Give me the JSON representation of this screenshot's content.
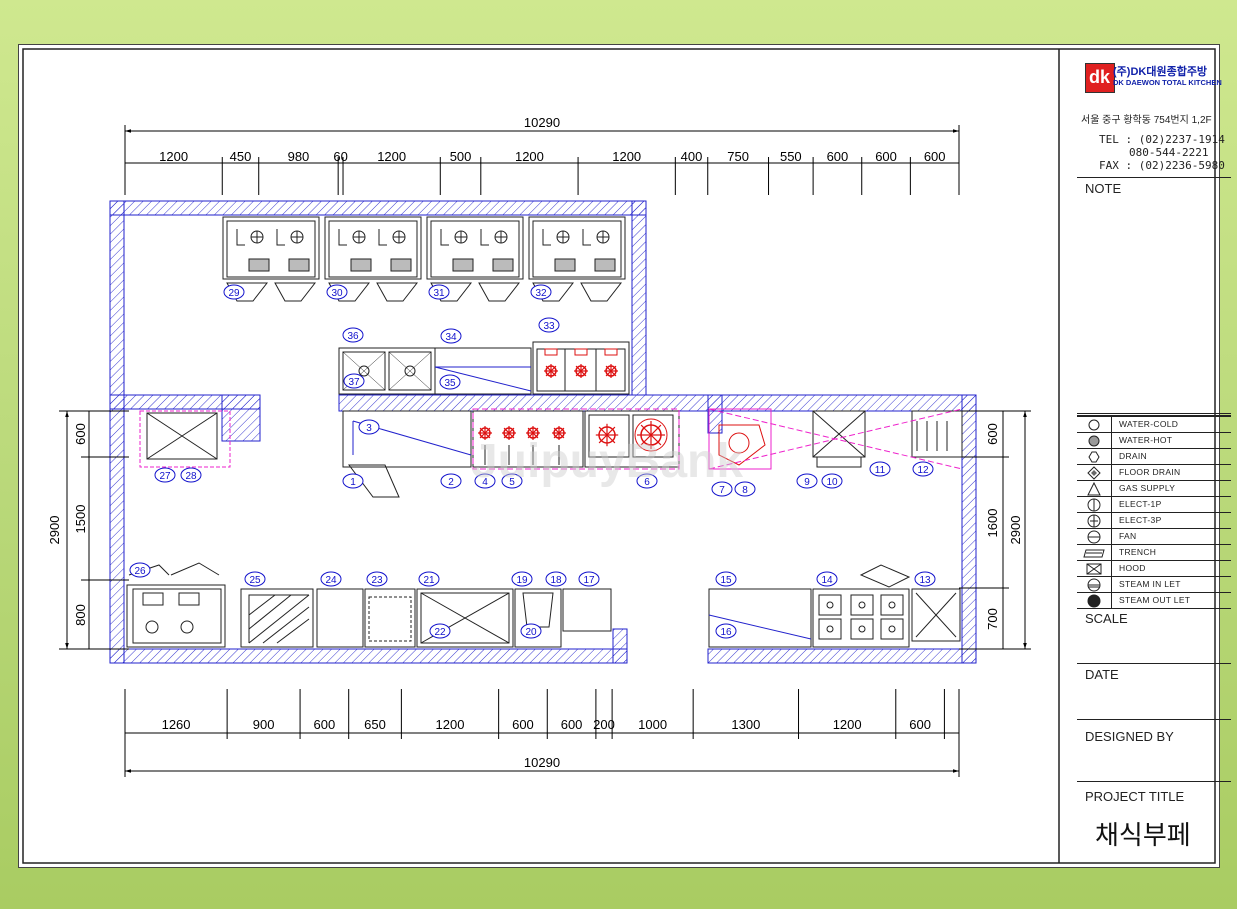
{
  "company": {
    "logo_text": "dk",
    "name_kr": "(주)DK대원종합주방",
    "name_en": "DK DAEWON TOTAL KITCHEN",
    "address": "서울 중구 황학동 754번지 1,2F",
    "tel": "TEL : (02)2237-1914",
    "tel2": "080-544-2221",
    "fax": "FAX : (02)2236-5980"
  },
  "title_block": {
    "note": "NOTE",
    "scale": "SCALE",
    "date": "DATE",
    "designed_by": "DESIGNED BY",
    "project_title_label": "PROJECT TITLE",
    "project_title": "채식부페"
  },
  "legend": [
    {
      "icon": "water-cold-icon",
      "label": "WATER-COLD"
    },
    {
      "icon": "water-hot-icon",
      "label": "WATER-HOT"
    },
    {
      "icon": "drain-icon",
      "label": "DRAIN"
    },
    {
      "icon": "floor-drain-icon",
      "label": "FLOOR DRAIN"
    },
    {
      "icon": "gas-supply-icon",
      "label": "GAS SUPPLY"
    },
    {
      "icon": "elect-1p-icon",
      "label": "ELECT-1P"
    },
    {
      "icon": "elect-3p-icon",
      "label": "ELECT-3P"
    },
    {
      "icon": "fan-icon",
      "label": "FAN"
    },
    {
      "icon": "trench-icon",
      "label": "TRENCH"
    },
    {
      "icon": "hood-icon",
      "label": "HOOD"
    },
    {
      "icon": "steam-in-let-icon",
      "label": "STEAM IN LET"
    },
    {
      "icon": "steam-out-let-icon",
      "label": "STEAM OUT LET"
    }
  ],
  "dimensions": {
    "top_total": "10290",
    "top_segments": [
      "1200",
      "450",
      "980",
      "60",
      "1200",
      "500",
      "1200",
      "1200",
      "400",
      "750",
      "550",
      "600",
      "600",
      "600"
    ],
    "bottom_total": "10290",
    "bottom_segments": [
      "1260",
      "900",
      "600",
      "650",
      "1200",
      "600",
      "600",
      "200",
      "1000",
      "1300",
      "1200",
      "600"
    ],
    "left_total": "2900",
    "left_segments": [
      "600",
      "1500",
      "800"
    ],
    "right_total": "2900",
    "right_segments": [
      "600",
      "1600",
      "700"
    ]
  },
  "equipment_numbers": [
    "29",
    "30",
    "31",
    "32",
    "36",
    "34",
    "33",
    "37",
    "35",
    "3",
    "1",
    "2",
    "4",
    "5",
    "6",
    "7",
    "8",
    "9",
    "10",
    "11",
    "12",
    "27",
    "28",
    "26",
    "25",
    "24",
    "23",
    "21",
    "19",
    "18",
    "17",
    "15",
    "14",
    "13",
    "22",
    "20",
    "16"
  ],
  "watermark": "JuipuyBank",
  "colors": {
    "wall": "#2222cc",
    "equipment": "#222222",
    "burner": "#dd1111",
    "hood": "#ee22cc",
    "tag": "#1111cc",
    "background": "#bcd97e"
  }
}
